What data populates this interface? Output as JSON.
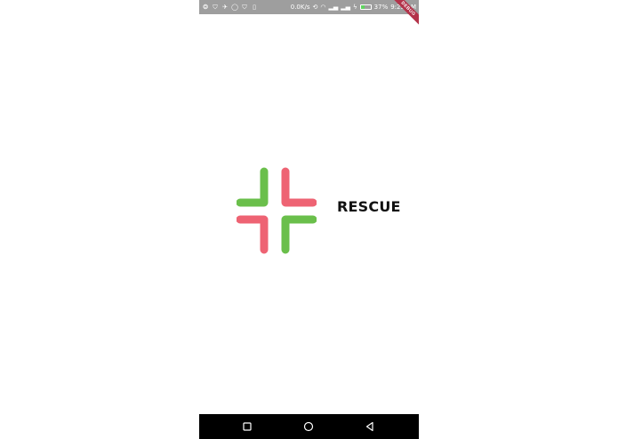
{
  "status_bar": {
    "left_icons": [
      "signal-app-icon",
      "shield-icon",
      "twitter-icon",
      "whatsapp-icon",
      "shield-icon",
      "phone-icon"
    ],
    "speed": "0.0K/s",
    "battery_percent": "37%",
    "battery_level": 0.37,
    "time": "9:25 AM",
    "bar_color": "#9e9e9e"
  },
  "debug_banner": {
    "label": "DEBUG",
    "color": "#b3334a"
  },
  "splash": {
    "app_name": "RESCUE",
    "logo_colors": {
      "green": "#6abf4b",
      "red": "#ee6373"
    }
  },
  "nav_bar": {
    "buttons": [
      "recents-square-icon",
      "home-circle-icon",
      "back-triangle-icon"
    ]
  }
}
